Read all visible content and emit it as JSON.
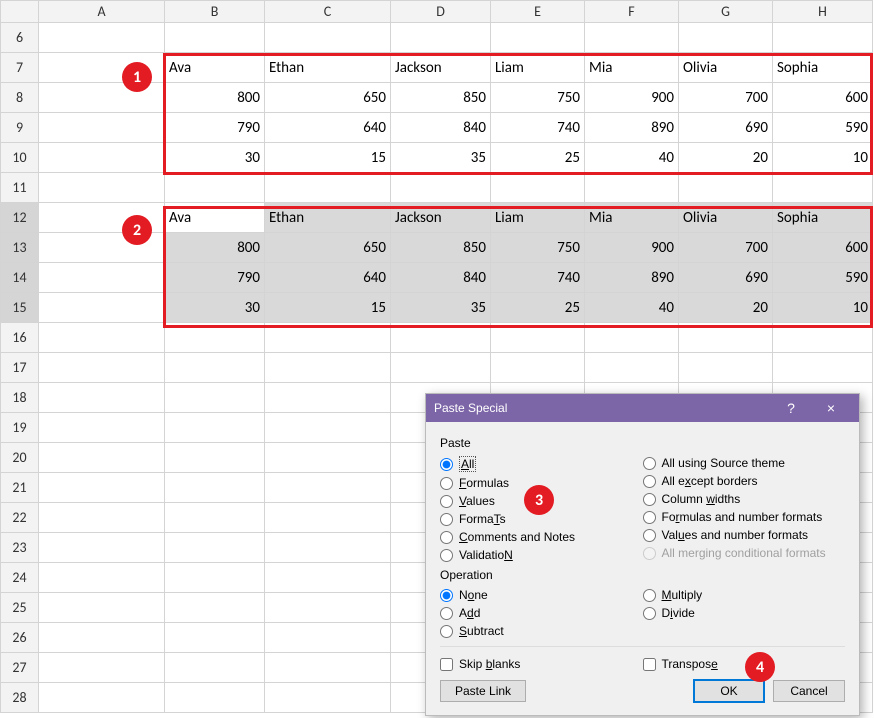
{
  "columns": [
    "A",
    "B",
    "C",
    "D",
    "E",
    "F",
    "G",
    "H"
  ],
  "rows": [
    "6",
    "7",
    "8",
    "9",
    "10",
    "11",
    "12",
    "13",
    "14",
    "15",
    "16",
    "17",
    "18",
    "19",
    "20",
    "21",
    "22",
    "23",
    "24",
    "25",
    "26",
    "27",
    "28"
  ],
  "block1": {
    "names": [
      "Ava",
      "Ethan",
      "Jackson",
      "Liam",
      "Mia",
      "Olivia",
      "Sophia"
    ],
    "r1": [
      "800",
      "650",
      "850",
      "750",
      "900",
      "700",
      "600"
    ],
    "r2": [
      "790",
      "640",
      "840",
      "740",
      "890",
      "690",
      "590"
    ],
    "r3": [
      "30",
      "15",
      "35",
      "25",
      "40",
      "20",
      "10"
    ]
  },
  "block2": {
    "names": [
      "Ava",
      "Ethan",
      "Jackson",
      "Liam",
      "Mia",
      "Olivia",
      "Sophia"
    ],
    "r1": [
      "800",
      "650",
      "850",
      "750",
      "900",
      "700",
      "600"
    ],
    "r2": [
      "790",
      "640",
      "840",
      "740",
      "890",
      "690",
      "590"
    ],
    "r3": [
      "30",
      "15",
      "35",
      "25",
      "40",
      "20",
      "10"
    ]
  },
  "callouts": {
    "c1": "1",
    "c2": "2",
    "c3": "3",
    "c4": "4"
  },
  "dialog": {
    "title": "Paste Special",
    "help": "?",
    "close": "×",
    "paste_label": "Paste",
    "operation_label": "Operation",
    "paste_left": [
      {
        "label": "All",
        "ul": "A",
        "rest": "ll"
      },
      {
        "label": "Formulas",
        "ul": "F",
        "rest": "ormulas"
      },
      {
        "label": "Values",
        "ul": "V",
        "rest": "alues"
      },
      {
        "label": "Formats",
        "ul": "T",
        "pre": "Forma",
        "rest": "s"
      },
      {
        "label": "Comments and Notes",
        "ul": "C",
        "rest": "omments and Notes"
      },
      {
        "label": "Validation",
        "ul": "N",
        "pre": "Validatio",
        "rest": ""
      }
    ],
    "paste_right": [
      {
        "label": "All using Source theme"
      },
      {
        "label": "All except borders",
        "pre": "All e",
        "ul": "x",
        "rest": "cept borders"
      },
      {
        "label": "Column widths",
        "pre": "Column ",
        "ul": "w",
        "rest": "idths"
      },
      {
        "label": "Formulas and number formats",
        "pre": "Fo",
        "ul": "r",
        "rest": "mulas and number formats"
      },
      {
        "label": "Values and number formats",
        "pre": "Val",
        "ul": "u",
        "rest": "es and number formats"
      },
      {
        "label": "All merging conditional formats"
      }
    ],
    "op_left": [
      {
        "label": "None",
        "ul": "o",
        "pre": "N",
        "rest": "ne"
      },
      {
        "label": "Add",
        "ul": "d",
        "pre": "A",
        "rest": "d"
      },
      {
        "label": "Subtract",
        "ul": "S",
        "rest": "ubtract"
      }
    ],
    "op_right": [
      {
        "label": "Multiply",
        "ul": "M",
        "rest": "ultiply"
      },
      {
        "label": "Divide",
        "ul": "i",
        "pre": "D",
        "rest": "vide"
      }
    ],
    "skip_blanks": {
      "pre": "Skip ",
      "ul": "b",
      "rest": "lanks"
    },
    "transpose": {
      "pre": "Transpos",
      "ul": "e",
      "rest": ""
    },
    "paste_link": {
      "pre": "Paste ",
      "ul": "L",
      "rest": "ink"
    },
    "ok": "OK",
    "cancel": "Cancel"
  }
}
